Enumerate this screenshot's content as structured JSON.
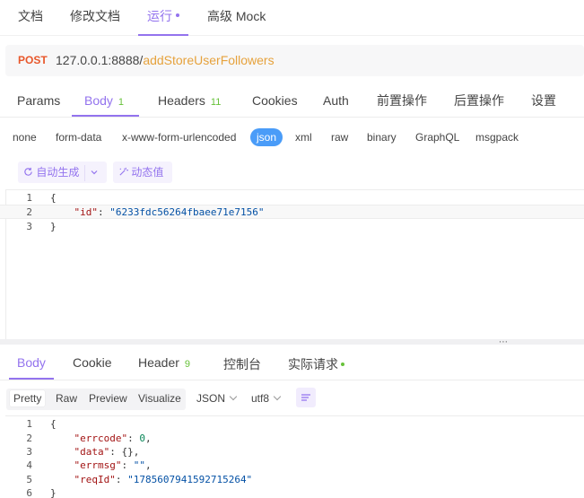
{
  "top_tabs": [
    {
      "label": "文档"
    },
    {
      "label": "修改文档"
    },
    {
      "label": "运行"
    },
    {
      "label": "高级 Mock"
    }
  ],
  "request": {
    "method": "POST",
    "host": "127.0.0.1:8888/",
    "path": "addStoreUserFollowers"
  },
  "request_tabs": {
    "params": "Params",
    "body": "Body",
    "body_count": "1",
    "headers": "Headers",
    "headers_count": "11",
    "cookies": "Cookies",
    "auth": "Auth",
    "pre": "前置操作",
    "post": "后置操作",
    "settings": "设置"
  },
  "body_types": [
    "none",
    "form-data",
    "x-www-form-urlencoded",
    "json",
    "xml",
    "raw",
    "binary",
    "GraphQL",
    "msgpack"
  ],
  "helpers": {
    "auto_generate": "自动生成",
    "dynamic_value": "动态值"
  },
  "request_body_lines": [
    {
      "num": "1",
      "indent": "",
      "key": "",
      "value": "",
      "punct": "{"
    },
    {
      "num": "2",
      "indent": "    ",
      "key": "\"id\"",
      "value": "\"6233fdc56264fbaee71e7156\"",
      "punct": ": "
    },
    {
      "num": "3",
      "indent": "",
      "key": "",
      "value": "",
      "punct": "}"
    }
  ],
  "response_tabs": {
    "body": "Body",
    "cookie": "Cookie",
    "header": "Header",
    "header_count": "9",
    "console": "控制台",
    "actual": "实际请求"
  },
  "response_toolbar": {
    "formats": [
      "Pretty",
      "Raw",
      "Preview",
      "Visualize"
    ],
    "lang": "JSON",
    "encoding": "utf8"
  },
  "response_body_lines": [
    {
      "num": "1",
      "text_a": "{",
      "key": "",
      "mid": "",
      "val": "",
      "tail": ""
    },
    {
      "num": "2",
      "text_a": "    ",
      "key": "\"errcode\"",
      "mid": ": ",
      "val": "0",
      "tail": ","
    },
    {
      "num": "3",
      "text_a": "    ",
      "key": "\"data\"",
      "mid": ": ",
      "val": "{}",
      "tail": ","
    },
    {
      "num": "4",
      "text_a": "    ",
      "key": "\"errmsg\"",
      "mid": ": ",
      "val": "\"\"",
      "tail": ","
    },
    {
      "num": "5",
      "text_a": "    ",
      "key": "\"reqId\"",
      "mid": ": ",
      "val": "\"1785607941592715264\"",
      "tail": ""
    },
    {
      "num": "6",
      "text_a": "}",
      "key": "",
      "mid": "",
      "val": "",
      "tail": ""
    }
  ],
  "colors": {
    "accent": "#9373ee",
    "method": "#e8572b",
    "path": "#e6a23c",
    "count_badge": "#67c23a",
    "json_pill": "#4a9cf8"
  }
}
